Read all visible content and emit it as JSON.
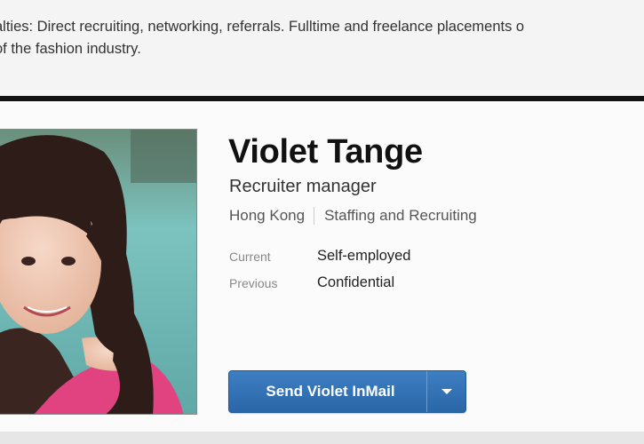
{
  "specialties": {
    "text": "alties: Direct recruiting, networking, referrals. Fulltime and freelance placements o\nof the fashion industry."
  },
  "profile": {
    "name": "Violet Tange",
    "headline": "Recruiter manager",
    "location": "Hong Kong",
    "industry": "Staffing and Recruiting",
    "experience": [
      {
        "label": "Current",
        "value": "Self-employed"
      },
      {
        "label": "Previous",
        "value": "Confidential"
      }
    ],
    "photo_alt": "profile-photo"
  },
  "actions": {
    "inmail_label": "Send Violet InMail",
    "dropdown_icon": "chevron-down-icon"
  },
  "colors": {
    "button_blue": "#2f6fb3",
    "divider": "#111111",
    "blouse_pink": "#e0437f",
    "pool_teal": "#6fb3b0"
  }
}
